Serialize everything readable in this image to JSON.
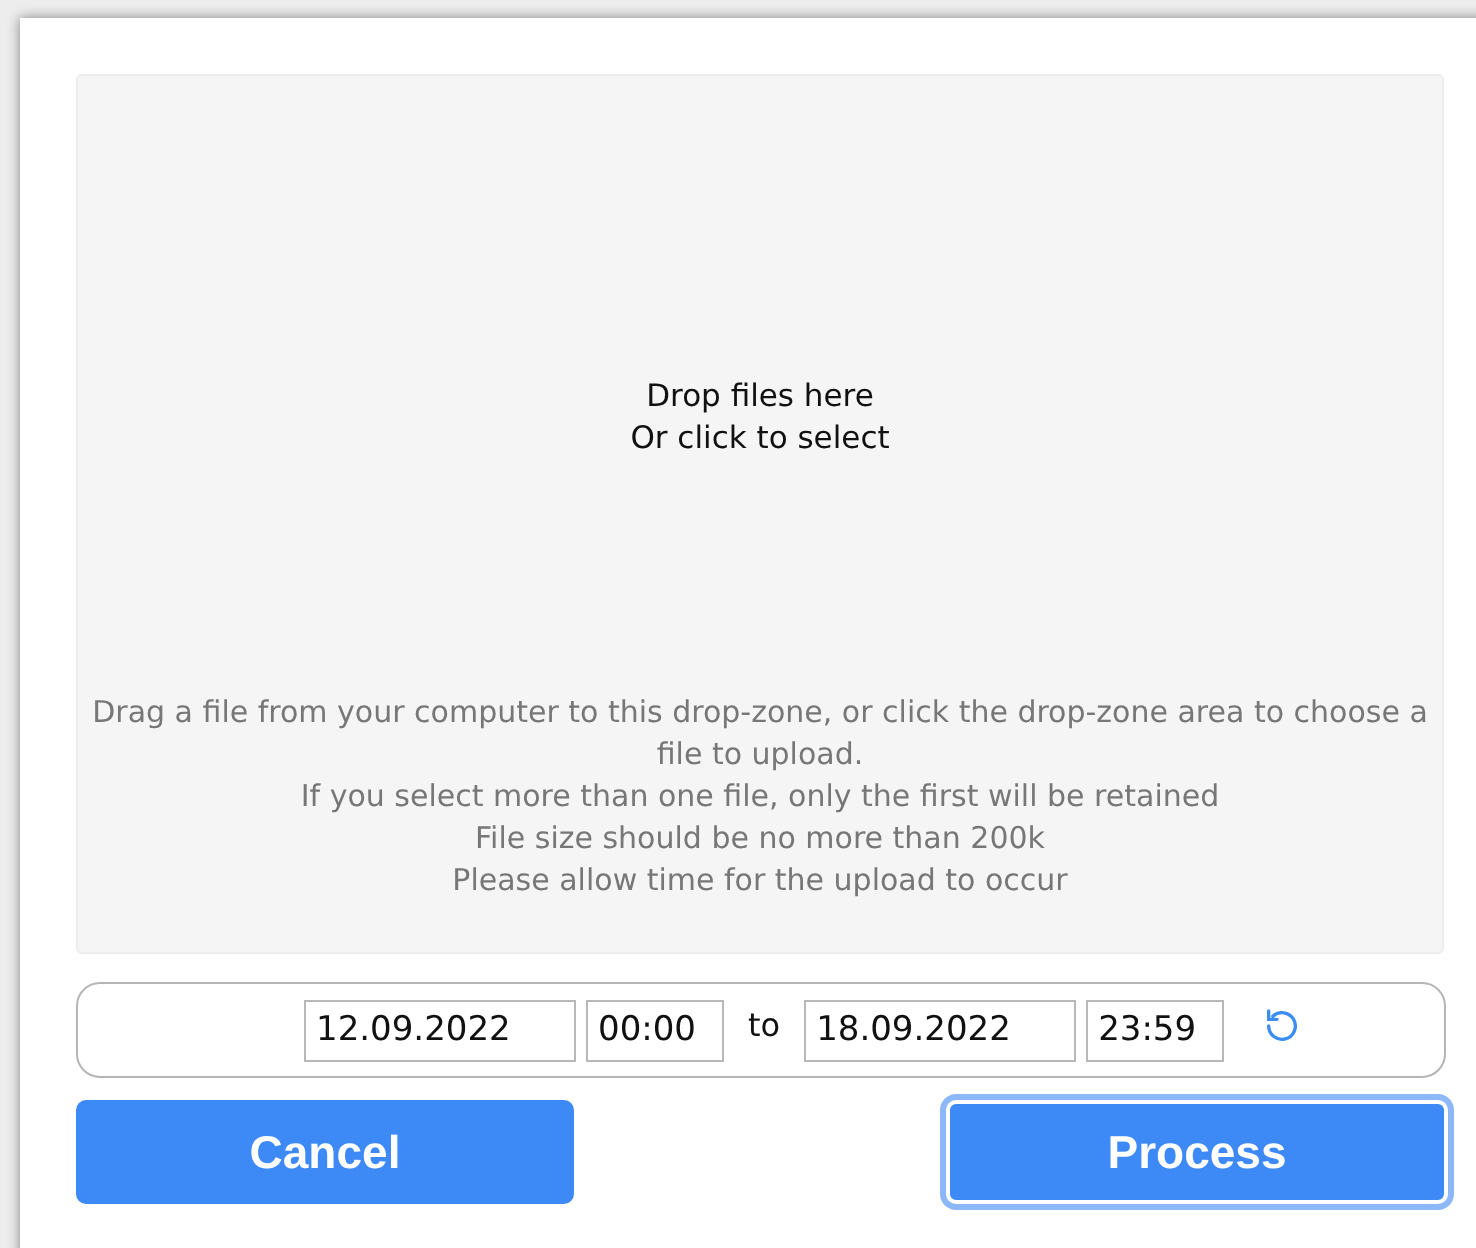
{
  "dropzone": {
    "title_lines": [
      "Drop files here",
      "Or click to select"
    ],
    "help_lines": [
      "Drag a file from your computer to this drop-zone, or click the drop-zone area to choose a file to upload.",
      "If you select more than one file, only the first will be retained",
      "File size should be no more than 200k",
      "Please allow time for the upload to occur"
    ]
  },
  "date_range": {
    "start_date": "12.09.2022",
    "start_time": "00:00",
    "separator": "to",
    "end_date": "18.09.2022",
    "end_time": "23:59"
  },
  "buttons": [
    {
      "label": "Cancel",
      "focused": false
    },
    {
      "label": "Process",
      "focused": true
    }
  ]
}
